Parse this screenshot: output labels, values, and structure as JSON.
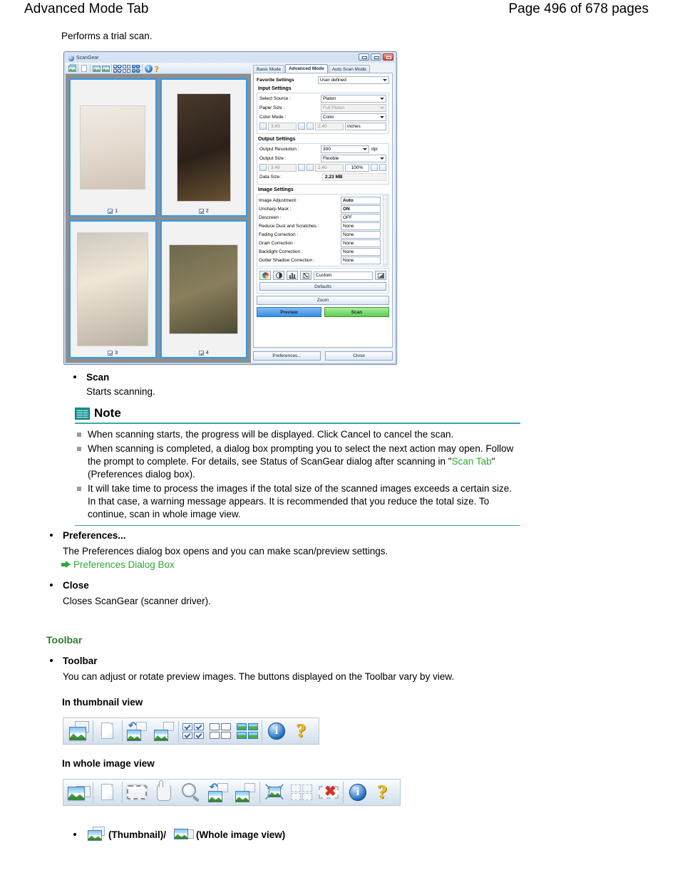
{
  "header": {
    "title": "Advanced Mode Tab",
    "page_label": "Page 496 of 678 pages"
  },
  "intro_text": "Performs a trial scan.",
  "scangear": {
    "window_title": "ScanGear",
    "window_buttons": [
      "minimize",
      "maximize",
      "close"
    ],
    "toolbar_icons": [
      "thumbnail-view-icon",
      "clear-icon",
      "rotate-left-icon",
      "rotate-right-icon",
      "select-all-frames-icon",
      "deselect-all-frames-icon",
      "select-all-images-icon",
      "info-icon",
      "help-icon"
    ],
    "thumbnails": [
      {
        "number": "1",
        "checked": true
      },
      {
        "number": "2",
        "checked": true
      },
      {
        "number": "3",
        "checked": true
      },
      {
        "number": "4",
        "checked": true
      }
    ],
    "tabs": [
      {
        "label": "Basic Mode",
        "active": false
      },
      {
        "label": "Advanced Mode",
        "active": true
      },
      {
        "label": "Auto Scan Mode",
        "active": false
      }
    ],
    "favorite_settings": {
      "label": "Favorite Settings",
      "value": "User defined"
    },
    "input_settings": {
      "title": "Input Settings",
      "rows": [
        {
          "label": "Select Source :",
          "value": "Platen",
          "dim": false
        },
        {
          "label": "Paper Size :",
          "value": "Full Platen",
          "dim": true
        },
        {
          "label": "Color Mode :",
          "value": "Color",
          "dim": false
        }
      ],
      "width": "3.49",
      "height": "2.40",
      "unit": "inches"
    },
    "output_settings": {
      "title": "Output Settings",
      "resolution_label": "Output Resolution :",
      "resolution_value": "300",
      "resolution_unit": "dpi",
      "size_label": "Output Size :",
      "size_value": "Flexible",
      "width": "3.49",
      "height": "2.40",
      "scale": "100%",
      "data_size_label": "Data Size :",
      "data_size_value": "2.23 MB"
    },
    "image_settings": {
      "title": "Image Settings",
      "rows": [
        {
          "label": "Image Adjustment :",
          "value": "Auto",
          "bold": true
        },
        {
          "label": "Unsharp Mask :",
          "value": "ON",
          "bold": true
        },
        {
          "label": "Descreen :",
          "value": "OFF",
          "bold": false
        },
        {
          "label": "Reduce Dust and Scratches :",
          "value": "None",
          "bold": false
        },
        {
          "label": "Fading Correction :",
          "value": "None",
          "bold": false
        },
        {
          "label": "Grain Correction :",
          "value": "None",
          "bold": false
        },
        {
          "label": "Backlight Correction :",
          "value": "None",
          "bold": false
        },
        {
          "label": "Gutter Shadow Correction :",
          "value": "None",
          "bold": false
        }
      ]
    },
    "adjust_buttons": [
      "color-adjustment-icon",
      "brightness-contrast-icon",
      "histogram-icon",
      "tone-curve-icon",
      "final-review-icon"
    ],
    "custom_value": "Custom",
    "defaults_label": "Defaults",
    "zoom_label": "Zoom",
    "preview_label": "Preview",
    "scan_label": "Scan",
    "preferences_label": "Preferences...",
    "close_label": "Close",
    "colors": {
      "preview_button": "#3a8de0",
      "scan_button": "#5ecb4e"
    }
  },
  "content": {
    "scan": {
      "title": "Scan",
      "text": "Starts scanning."
    },
    "note": {
      "title": "Note",
      "items": [
        "When scanning starts, the progress will be displayed. Click Cancel to cancel the scan.",
        "When scanning is completed, a dialog box prompting you to select the next action may open. Follow the prompt to complete. For details, see Status of ScanGear dialog after scanning in \"",
        "It will take time to process the images if the total size of the scanned images exceeds a certain size. In that case, a warning message appears. It is recommended that you reduce the total size. To continue, scan in whole image view."
      ],
      "item2_link": "Scan Tab",
      "item2_tail": "\" (Preferences dialog box)."
    },
    "preferences": {
      "title": "Preferences...",
      "text": "The Preferences dialog box opens and you can make scan/preview settings.",
      "link": "Preferences Dialog Box"
    },
    "close": {
      "title": "Close",
      "text": "Closes ScanGear (scanner driver)."
    },
    "toolbar_section": {
      "heading": "Toolbar",
      "title": "Toolbar",
      "text": "You can adjust or rotate preview images. The buttons displayed on the Toolbar vary by view.",
      "thumbnail_view_label": "In thumbnail view",
      "whole_image_view_label": "In whole image view"
    },
    "thumbnail_toolbar_icons": [
      "thumbnail-view-icon",
      "clear-icon",
      "rotate-left-icon",
      "rotate-right-icon",
      "select-all-frames-icon",
      "deselect-all-frames-icon",
      "select-all-images-icon",
      "info-icon",
      "help-icon"
    ],
    "whole_image_toolbar_icons": [
      "whole-image-view-icon",
      "clear-icon",
      "crop-icon",
      "move-image-icon",
      "zoom-in-icon",
      "rotate-left-icon",
      "rotate-right-icon",
      "auto-crop-icon",
      "select-all-crop-frames-icon",
      "remove-crop-frame-icon",
      "info-icon",
      "help-icon"
    ],
    "view_toggle": {
      "thumbnail_label": "(Thumbnail)/",
      "whole_label": "(Whole image view)"
    }
  },
  "colors": {
    "link_green": "#2ea836",
    "heading_green": "#2f7d32",
    "note_rule": "#3ba7a7"
  }
}
